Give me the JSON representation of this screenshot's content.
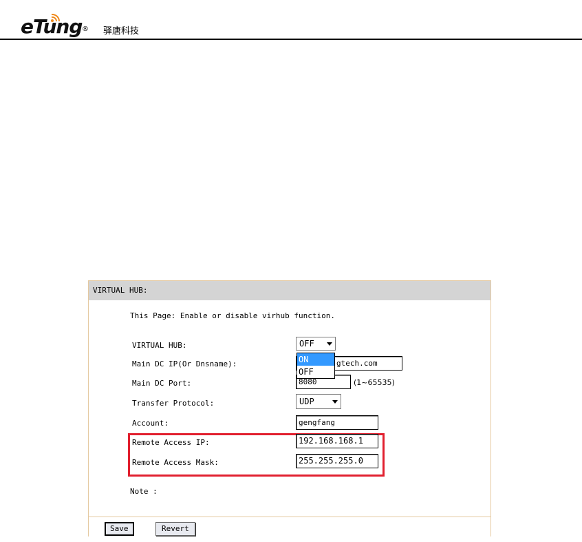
{
  "header": {
    "logo_text": "eTung",
    "logo_reg": "®",
    "brand_cn": "驿唐科技",
    "logo_icon": "wifi-signal-icon"
  },
  "panel": {
    "title": "VIRTUAL HUB:",
    "description": "This Page: Enable or disable virhub function.",
    "fields": {
      "virtual_hub": {
        "label": "VIRTUAL HUB:",
        "value": "OFF",
        "options": [
          "ON",
          "OFF"
        ],
        "highlighted": "ON"
      },
      "main_dc_ip": {
        "label": "Main DC IP(Or Dnsname):",
        "value": "gtech.com"
      },
      "main_dc_port": {
        "label": "Main DC Port:",
        "value": "8080",
        "range": "(1~65535)"
      },
      "transfer_protocol": {
        "label": "Transfer Protocol:",
        "value": "UDP"
      },
      "account": {
        "label": "Account:",
        "value": "gengfang"
      },
      "remote_access_ip": {
        "label": "Remote Access IP:",
        "value": "192.168.168.1"
      },
      "remote_access_mask": {
        "label": "Remote Access Mask:",
        "value": "255.255.255.0"
      }
    },
    "note": "Note :",
    "highlight_color": "#e11f2e"
  },
  "footer": {
    "save_label": "Save",
    "revert_label": "Revert"
  }
}
